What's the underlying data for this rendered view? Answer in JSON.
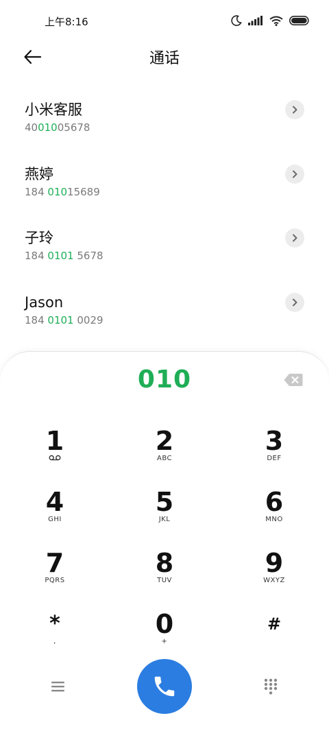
{
  "status": {
    "time": "上午8:16"
  },
  "header": {
    "title": "通话"
  },
  "contacts": [
    {
      "name": "小米客服",
      "number": {
        "pre": "40",
        "match": "010",
        "post": "05678"
      }
    },
    {
      "name": "燕婷",
      "number": {
        "pre": "184 ",
        "match": "010",
        "post": "15689"
      }
    },
    {
      "name": "子玲",
      "number": {
        "pre": "184 ",
        "match": "0101",
        "post": " 5678"
      }
    },
    {
      "name": "Jason",
      "number": {
        "pre": "184 ",
        "match": "0101",
        "post": " 0029"
      }
    }
  ],
  "dialpad": {
    "input": "010",
    "keys": [
      {
        "digit": "1",
        "sub": ""
      },
      {
        "digit": "2",
        "sub": "ABC"
      },
      {
        "digit": "3",
        "sub": "DEF"
      },
      {
        "digit": "4",
        "sub": "GHI"
      },
      {
        "digit": "5",
        "sub": "JKL"
      },
      {
        "digit": "6",
        "sub": "MNO"
      },
      {
        "digit": "7",
        "sub": "PQRS"
      },
      {
        "digit": "8",
        "sub": "TUV"
      },
      {
        "digit": "9",
        "sub": "WXYZ"
      },
      {
        "digit": "*",
        "sub": ","
      },
      {
        "digit": "0",
        "sub": "+"
      },
      {
        "digit": "#",
        "sub": ""
      }
    ]
  },
  "icons": {
    "back": "back-arrow-icon",
    "chevron": "chevron-right-icon",
    "backspace": "backspace-icon",
    "voicemail": "voicemail-icon",
    "menu": "menu-icon",
    "call": "phone-icon",
    "dialpad": "dialpad-icon"
  },
  "colors": {
    "accent": "#1fae57",
    "call": "#2b7de1"
  }
}
